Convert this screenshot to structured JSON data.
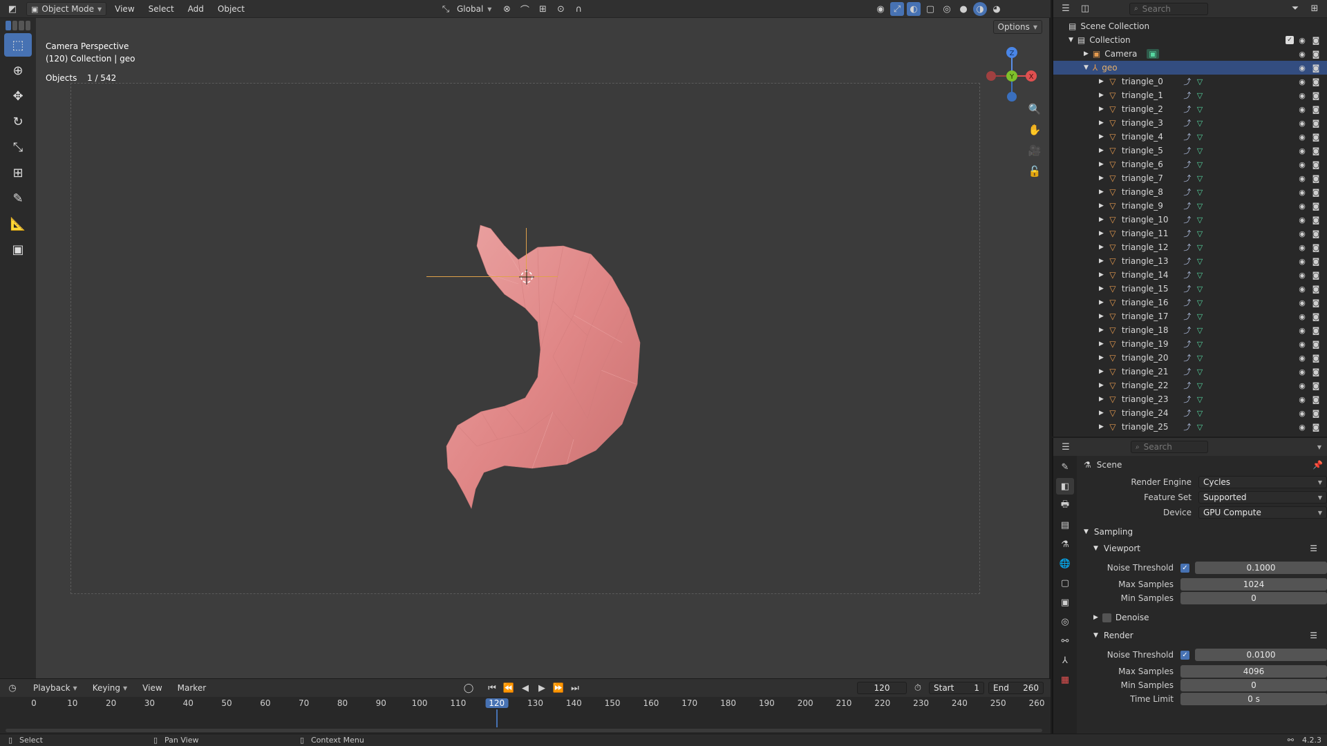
{
  "header": {
    "mode": "Object Mode",
    "menus": [
      "View",
      "Select",
      "Add",
      "Object"
    ],
    "transform_orientation": "Global"
  },
  "viewport": {
    "options_label": "Options",
    "camera_text": "Camera Perspective",
    "collection_text": "(120) Collection | geo",
    "objects_label": "Objects",
    "objects_count": "1 / 542",
    "gizmo": {
      "z": "Z",
      "y": "Y",
      "x": "X"
    }
  },
  "outliner": {
    "search_placeholder": "Search",
    "scene_collection": "Scene Collection",
    "collection": "Collection",
    "camera": "Camera",
    "geo": "geo",
    "items": [
      "triangle_0",
      "triangle_1",
      "triangle_2",
      "triangle_3",
      "triangle_4",
      "triangle_5",
      "triangle_6",
      "triangle_7",
      "triangle_8",
      "triangle_9",
      "triangle_10",
      "triangle_11",
      "triangle_12",
      "triangle_13",
      "triangle_14",
      "triangle_15",
      "triangle_16",
      "triangle_17",
      "triangle_18",
      "triangle_19",
      "triangle_20",
      "triangle_21",
      "triangle_22",
      "triangle_23",
      "triangle_24",
      "triangle_25"
    ]
  },
  "properties": {
    "search_placeholder": "Search",
    "context": "Scene",
    "render_engine_label": "Render Engine",
    "render_engine": "Cycles",
    "feature_set_label": "Feature Set",
    "feature_set": "Supported",
    "device_label": "Device",
    "device": "GPU Compute",
    "sampling": "Sampling",
    "viewport": "Viewport",
    "noise_threshold_label": "Noise Threshold",
    "viewport_noise_threshold": "0.1000",
    "max_samples_label": "Max Samples",
    "viewport_max_samples": "1024",
    "min_samples_label": "Min Samples",
    "viewport_min_samples": "0",
    "denoise": "Denoise",
    "render": "Render",
    "render_noise_threshold": "0.0100",
    "render_max_samples": "4096",
    "render_min_samples": "0",
    "time_limit_label": "Time Limit",
    "time_limit": "0 s"
  },
  "timeline": {
    "menus": [
      "Playback",
      "Keying",
      "View",
      "Marker"
    ],
    "current_frame": "120",
    "start_label": "Start",
    "start": "1",
    "end_label": "End",
    "end": "260",
    "ticks": [
      "0",
      "10",
      "20",
      "30",
      "40",
      "50",
      "60",
      "70",
      "80",
      "90",
      "100",
      "110",
      "120",
      "130",
      "140",
      "150",
      "160",
      "170",
      "180",
      "190",
      "200",
      "210",
      "220",
      "230",
      "240",
      "250",
      "260"
    ]
  },
  "statusbar": {
    "select": "Select",
    "pan_view": "Pan View",
    "context_menu": "Context Menu",
    "version": "4.2.3"
  },
  "colors": {
    "accent": "#4772b3",
    "selection_row": "#334d80",
    "object_orange": "#e59a4e",
    "mesh_green": "#56d6a0",
    "stomach_pink": "#e3898a"
  }
}
